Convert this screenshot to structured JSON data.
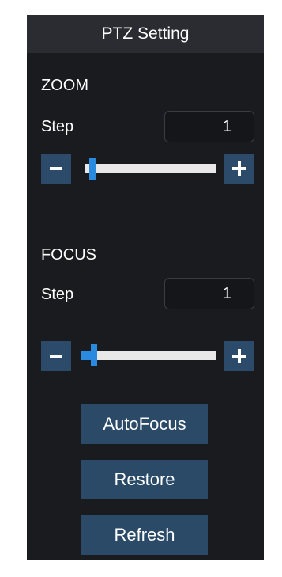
{
  "header": {
    "title": "PTZ Setting"
  },
  "zoom": {
    "title": "ZOOM",
    "step_label": "Step",
    "step_value": "1",
    "slider_level": 0.03
  },
  "focus": {
    "title": "FOCUS",
    "step_label": "Step",
    "step_value": "1",
    "slider_level": 0.08
  },
  "actions": {
    "autofocus": "AutoFocus",
    "restore": "Restore",
    "refresh": "Refresh"
  },
  "colors": {
    "panel_bg": "#1a1b1f",
    "header_bg": "#2a2c31",
    "button_bg": "#2a4a68",
    "slider_accent": "#2a8ae0"
  }
}
